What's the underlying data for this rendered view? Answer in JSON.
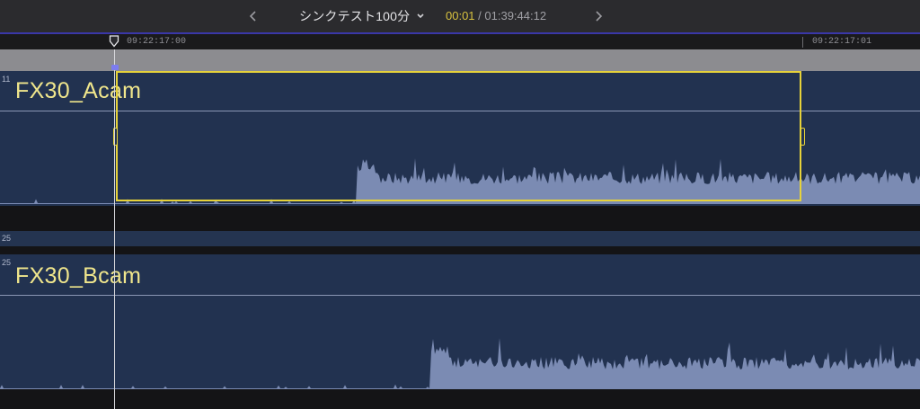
{
  "header": {
    "project_title": "シンクテスト100分",
    "timecode_current": "00:01",
    "timecode_separator": " / ",
    "timecode_total": "01:39:44:12"
  },
  "ruler": {
    "left_label": "09:22:17:00",
    "right_label": "09:22:17:01"
  },
  "clips": {
    "a": {
      "name": "FX30_Acam",
      "number": "11"
    },
    "thin": {
      "number": "25"
    },
    "b": {
      "name": "FX30_Bcam",
      "number": "25"
    }
  },
  "colors": {
    "accent": "#3a37a8",
    "selection": "#e6d23a",
    "clip_bg": "#223250",
    "waveform": "#7b8bb3",
    "clip_title": "#f0e68c"
  },
  "icons": {
    "prev": "chevron-left-icon",
    "next": "chevron-right-icon",
    "dropdown": "chevron-down-icon",
    "playhead": "playhead-marker-icon"
  }
}
